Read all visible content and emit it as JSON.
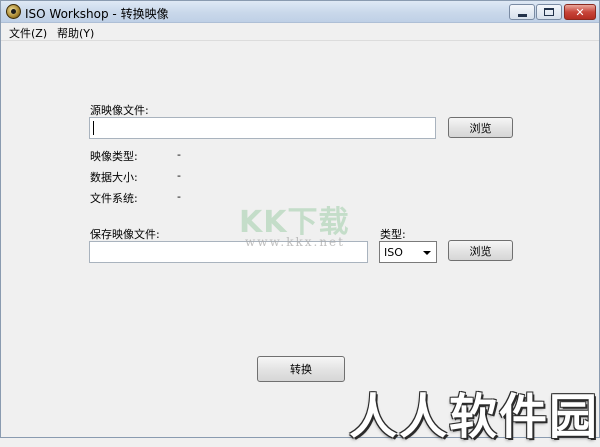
{
  "window": {
    "title": "ISO Workshop - 转换映像",
    "icon": "disc-icon",
    "controls": {
      "minimize": "minimize-icon",
      "maximize": "maximize-icon",
      "close": "✕"
    }
  },
  "menu": {
    "items": [
      {
        "label": "文件(Z)"
      },
      {
        "label": "帮助(Y)"
      }
    ]
  },
  "source": {
    "label": "源映像文件:",
    "value": "",
    "browse_label": "浏览"
  },
  "info": {
    "image_type": {
      "label": "映像类型:",
      "value": "-"
    },
    "data_size": {
      "label": "数据大小:",
      "value": "-"
    },
    "file_system": {
      "label": "文件系统:",
      "value": "-"
    }
  },
  "target": {
    "label": "保存映像文件:",
    "value": "",
    "type_label": "类型:",
    "type_selected": "ISO",
    "browse_label": "浏览"
  },
  "convert_label": "转换",
  "watermarks": {
    "kk": "KK下载",
    "url": "www.kkx.net",
    "brand": "人人软件园"
  },
  "colors": {
    "background": "#f0f0f0",
    "close_button": "#c8453a"
  }
}
